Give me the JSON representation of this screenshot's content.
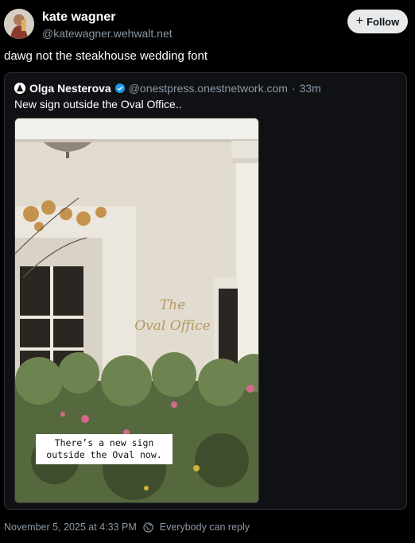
{
  "author": {
    "name": "kate wagner",
    "handle": "@katewagner.wehwalt.net",
    "follow_label": "Follow"
  },
  "post": {
    "text": "dawg not the steakhouse wedding font"
  },
  "quote": {
    "name": "Olga Nesterova",
    "handle": "@onestpress.onestnetwork.com",
    "separator": "·",
    "time": "33m",
    "text": "New sign outside the Oval Office..",
    "image": {
      "sign_line1": "The",
      "sign_line2": "Oval Office",
      "caption_line1": "There’s a new sign",
      "caption_line2": "outside the Oval now."
    }
  },
  "footer": {
    "timestamp": "November 5, 2025 at 4:33 PM",
    "reply_setting": "Everybody can reply"
  },
  "colors": {
    "background": "#000000",
    "secondary_text": "#8b98a5",
    "verified": "#1d9bf0",
    "follow_bg": "#e7e9ea"
  }
}
